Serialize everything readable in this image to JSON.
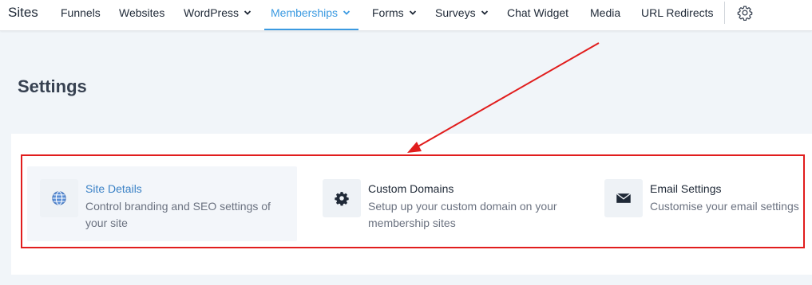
{
  "nav": {
    "brand": "Sites",
    "items": [
      {
        "label": "Funnels",
        "dropdown": false,
        "active": false
      },
      {
        "label": "Websites",
        "dropdown": false,
        "active": false
      },
      {
        "label": "WordPress",
        "dropdown": true,
        "active": false
      },
      {
        "label": "Memberships",
        "dropdown": true,
        "active": true
      },
      {
        "label": "Forms",
        "dropdown": true,
        "active": false
      },
      {
        "label": "Surveys",
        "dropdown": true,
        "active": false
      },
      {
        "label": "Chat Widget",
        "dropdown": false,
        "active": false
      },
      {
        "label": "Media",
        "dropdown": false,
        "active": false
      },
      {
        "label": "URL Redirects",
        "dropdown": false,
        "active": false
      }
    ],
    "settings_icon": "gear-icon"
  },
  "page": {
    "title": "Settings"
  },
  "settings_cards": [
    {
      "title": "Site Details",
      "description": "Control branding and SEO settings of your site",
      "icon": "globe-icon",
      "selected": true
    },
    {
      "title": "Custom Domains",
      "description": "Setup up your custom domain on your membership sites",
      "icon": "gear-icon",
      "selected": false
    },
    {
      "title": "Email Settings",
      "description": "Customise your email settings",
      "icon": "envelope-icon",
      "selected": false
    }
  ],
  "annotation": {
    "color": "#e11d1d"
  },
  "colors": {
    "accent": "#3b9ae1",
    "background": "#f1f5f9"
  }
}
